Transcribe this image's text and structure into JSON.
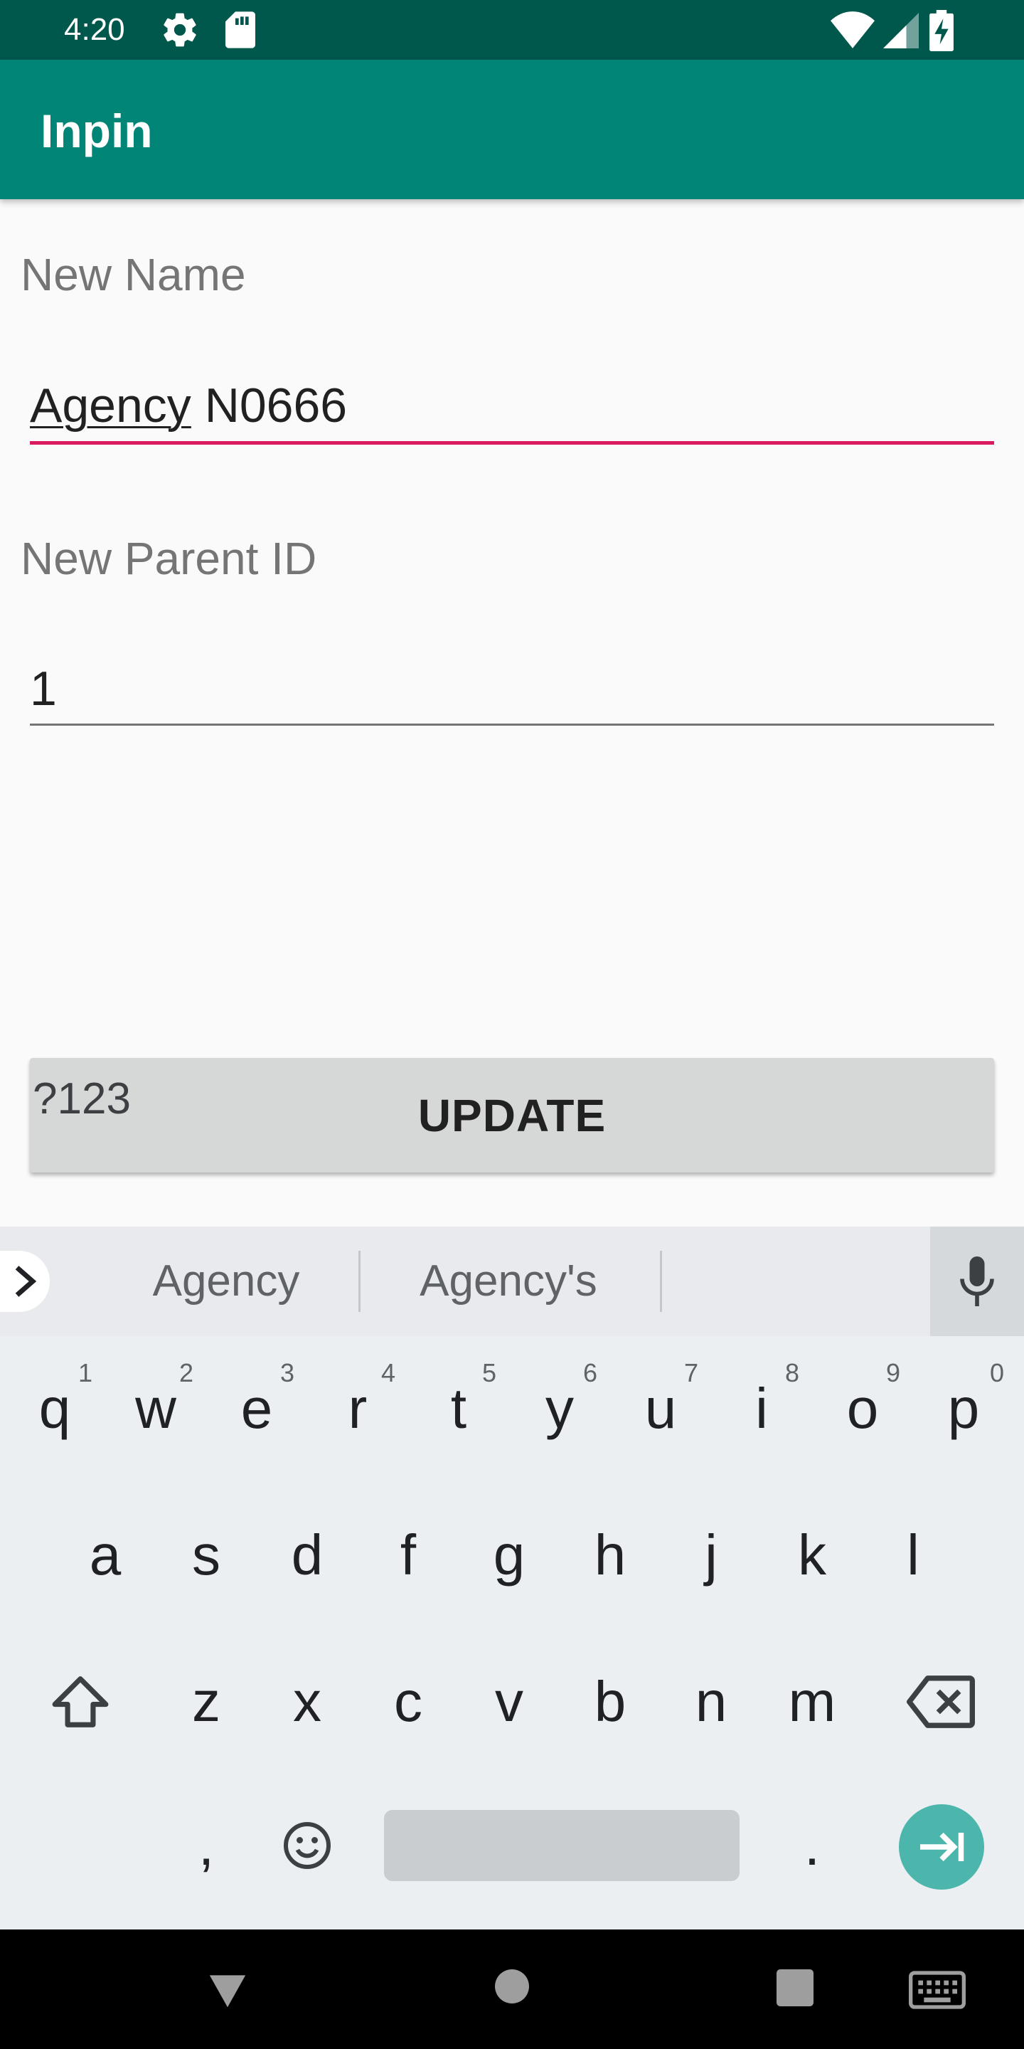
{
  "status_bar": {
    "time": "4:20",
    "icons_left": [
      "gear-icon",
      "sd-card-icon"
    ],
    "icons_right": [
      "wifi-icon",
      "cell-signal-icon",
      "battery-charging-icon"
    ]
  },
  "app_bar": {
    "title": "Inpin"
  },
  "form": {
    "name_label": "New Name",
    "name_value_word": "Agency",
    "name_value_rest": " N0666",
    "parent_label": "New Parent ID",
    "parent_value": "1",
    "update_label": "UPDATE"
  },
  "keyboard": {
    "suggestions": [
      "Agency",
      "Agency's"
    ],
    "row1": [
      "q",
      "w",
      "e",
      "r",
      "t",
      "y",
      "u",
      "i",
      "o",
      "p"
    ],
    "row1_hints": [
      "1",
      "2",
      "3",
      "4",
      "5",
      "6",
      "7",
      "8",
      "9",
      "0"
    ],
    "row2": [
      "a",
      "s",
      "d",
      "f",
      "g",
      "h",
      "j",
      "k",
      "l"
    ],
    "row3": [
      "z",
      "x",
      "c",
      "v",
      "b",
      "n",
      "m"
    ],
    "row4": {
      "symbols": "?123",
      "comma": ",",
      "period": "."
    }
  },
  "colors": {
    "status_bar": "#00574b",
    "app_bar": "#008577",
    "accent_underline": "#d81b60",
    "enter_key": "#4db6ac"
  }
}
